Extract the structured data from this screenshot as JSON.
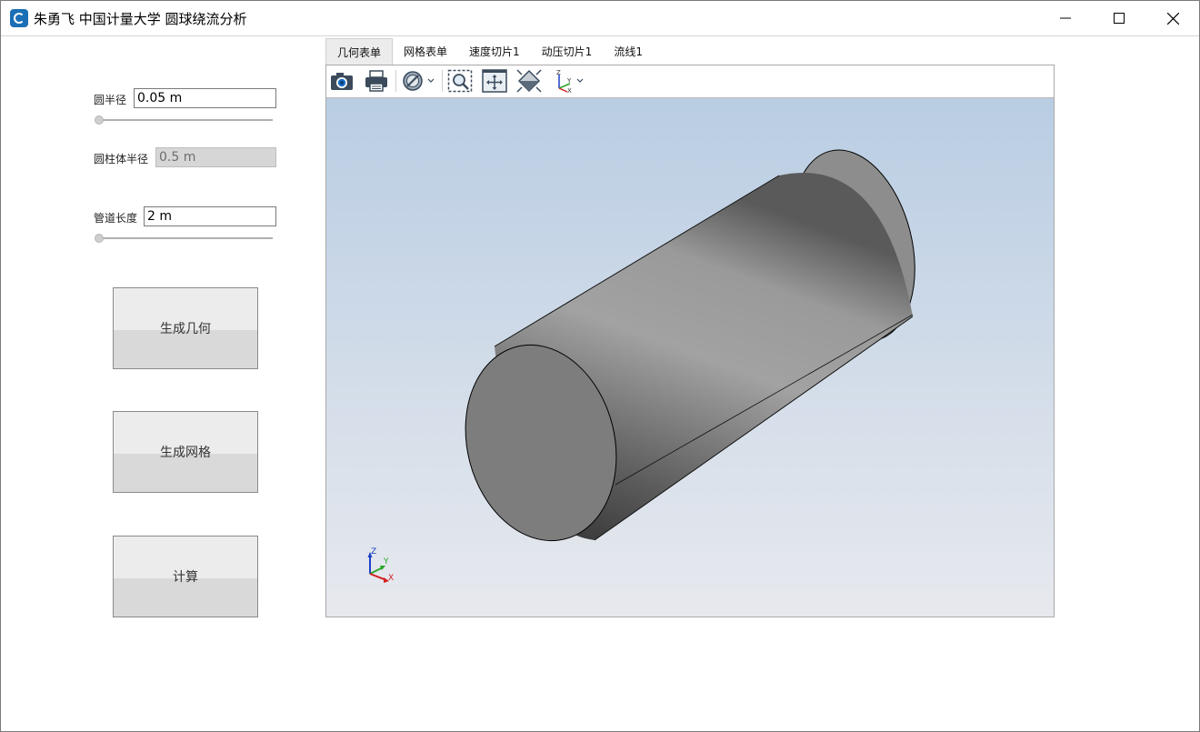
{
  "window": {
    "title": "朱勇飞 中国计量大学 圆球绕流分析",
    "controls": [
      "minimize-icon",
      "maximize-icon",
      "close-icon"
    ]
  },
  "left_panel": {
    "radius": {
      "label": "圆半径",
      "value": "0.05 m"
    },
    "cylinder_radius": {
      "label": "圆柱体半径",
      "value": "0.5 m"
    },
    "pipe_length": {
      "label": "管道长度",
      "value": "2 m"
    },
    "buttons": {
      "generate_geometry": "生成几何",
      "generate_mesh": "生成网格",
      "compute": "计算"
    }
  },
  "tabs": [
    "几何表单",
    "网格表单",
    "速度切片1",
    "动压切片1",
    "流线1"
  ],
  "active_tab": "几何表单",
  "toolbar": {
    "icons": [
      "camera-icon",
      "print-icon",
      "render-mode-icon",
      "zoom-box-icon",
      "fit-view-icon",
      "view-cube-icon",
      "axes-orientation-icon"
    ]
  },
  "viewport": {
    "axis_labels": {
      "z": "Z",
      "y": "Y",
      "x": "X"
    },
    "colors": {
      "bg_top": "#b9cde3",
      "bg_bottom": "#e7e9ee",
      "x_axis": "#d42020",
      "y_axis": "#2aa52a",
      "z_axis": "#1f3fc9"
    }
  }
}
